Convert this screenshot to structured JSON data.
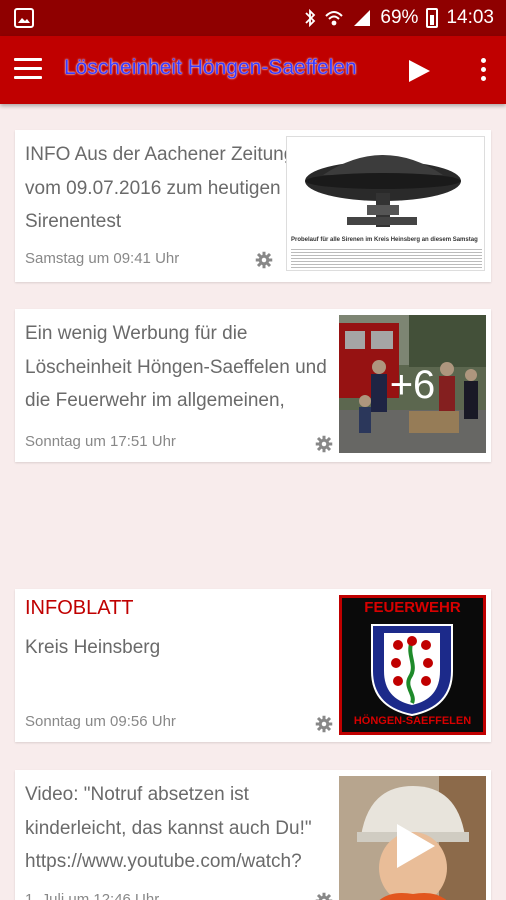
{
  "statusbar": {
    "battery": "69%",
    "time": "14:03"
  },
  "appbar": {
    "title": "Löscheinheit Höngen-Saeffelen"
  },
  "cards": [
    {
      "text": "INFO Aus der Aachener Zeitung vom 09.07.2016 zum heutigen Sirenentest",
      "date": "Samstag um 09:41 Uhr",
      "caption": "Probelauf für alle Sirenen im Kreis Heinsberg an diesem Samstag"
    },
    {
      "text": "Ein wenig Werbung für die Löscheinheit Höngen-Saeffelen und die Feuerwehr im allgemeinen,",
      "date": "Sonntag um 17:51 Uhr",
      "more_count": "+6"
    },
    {
      "title": "INFOBLATT",
      "text": "Kreis Heinsberg",
      "date": "Sonntag um 09:56 Uhr",
      "badge_top": "FEUERWEHR",
      "badge_bottom": "HÖNGEN-SAEFFELEN"
    },
    {
      "text": "Video: \"Notruf absetzen ist kinderleicht, das kannst auch Du!\" https://www.youtube.com/watch?",
      "date": "1. Juli um 12:46 Uhr"
    }
  ],
  "colors": {
    "statusbar": "#8f0000",
    "appbar": "#c00000",
    "title": "#3a3aff",
    "background": "#f8ecec",
    "accent": "#c00000"
  }
}
